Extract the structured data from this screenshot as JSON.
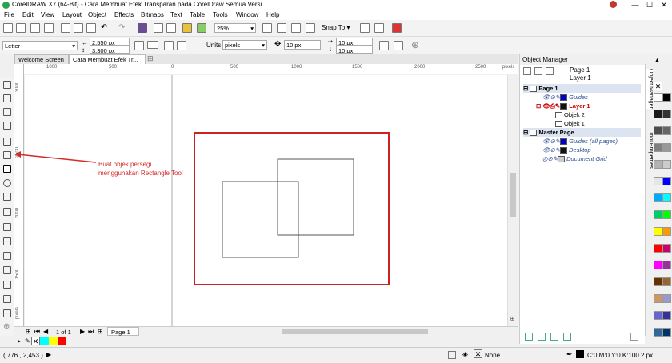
{
  "window": {
    "title": "CorelDRAW X7 (64-Bit) - Cara Membuat Efek Transparan pada CorelDraw Semua Versi",
    "min_label": "—",
    "max_label": "☐",
    "close_label": "✕"
  },
  "menu": [
    "File",
    "Edit",
    "View",
    "Layout",
    "Object",
    "Effects",
    "Bitmaps",
    "Text",
    "Table",
    "Tools",
    "Window",
    "Help"
  ],
  "standard_toolbar": {
    "zoom": "25%",
    "snap_to": "Snap To"
  },
  "property_bar": {
    "page_size": "Letter",
    "width": "2,550 px",
    "height": "3,300 px",
    "units_label": "Units:",
    "units": "pixels",
    "nudge": "10 px",
    "dup_x": "10 px",
    "dup_y": "10 px"
  },
  "tabs": [
    "Welcome Screen",
    "Cara Membuat Efek Tr..."
  ],
  "ruler": {
    "h_ticks": [
      "1000",
      "500",
      "0",
      "500",
      "1000",
      "1500",
      "2000",
      "2500"
    ],
    "h_unit": "pixels",
    "v_ticks": [
      "3000",
      "2500",
      "2000",
      "1500"
    ],
    "v_unit": "pixels"
  },
  "annotation": {
    "text": "Buat objek persegi menggunakan Rectangle Tool",
    "color": "#d42a2a"
  },
  "page_nav": {
    "counter": "1 of 1",
    "page_tab": "Page 1"
  },
  "object_manager": {
    "title": "Object Manager",
    "page_label": "Page 1",
    "layer_label": "Layer 1",
    "rows": [
      {
        "label": "Page 1"
      },
      {
        "label": "Guides"
      },
      {
        "label": "Layer 1"
      },
      {
        "label": "Objek 2"
      },
      {
        "label": "Objek 1"
      },
      {
        "label": "Master Page"
      },
      {
        "label": "Guides (all pages)"
      },
      {
        "label": "Desktop"
      },
      {
        "label": "Document Grid"
      }
    ]
  },
  "side_tabs": [
    "Object Manager",
    "Tool Properties"
  ],
  "status_bar": {
    "coords": "( 776 , 2,453 )",
    "fill": "None",
    "outline": "C:0 M:0 Y:0 K:100  2 px"
  },
  "colors": {
    "page_border": "#cc2222",
    "palette": [
      "#ffffff",
      "#000000",
      "#1a1a1a",
      "#333333",
      "#4d4d4d",
      "#666666",
      "#808080",
      "#999999",
      "#b3b3b3",
      "#cccccc",
      "#e6e6e6",
      "#0000ff",
      "#00aaff",
      "#00ffff",
      "#00cc66",
      "#00ff00",
      "#ffff00",
      "#ff9900",
      "#ff0000",
      "#cc0066",
      "#ff00ff",
      "#993399",
      "#663300",
      "#996633",
      "#cc9966",
      "#9999cc",
      "#6666cc",
      "#333399",
      "#336699",
      "#003366"
    ]
  }
}
